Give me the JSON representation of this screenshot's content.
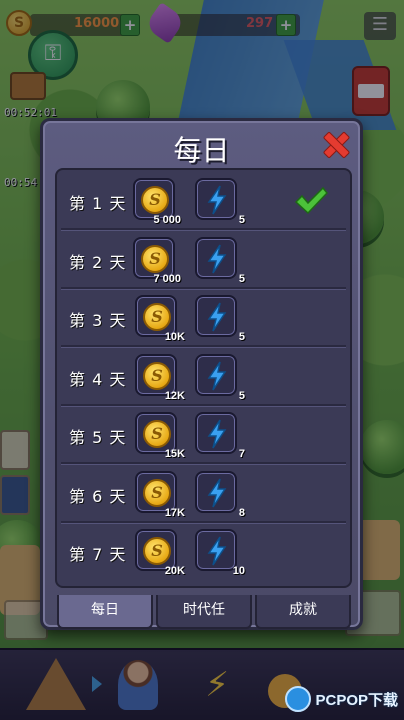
{
  "hud": {
    "coins": "16000",
    "gems": "297",
    "plus": "+",
    "timer_top": "00:52:01",
    "timer_bottom": "00:54"
  },
  "dialog": {
    "title": "每日",
    "close_icon": "close-x-icon",
    "days": [
      {
        "label": "第 1 天",
        "coins": "5 000",
        "energy": "5",
        "claimed": true
      },
      {
        "label": "第 2 天",
        "coins": "7 000",
        "energy": "5",
        "claimed": false
      },
      {
        "label": "第 3 天",
        "coins": "10K",
        "energy": "5",
        "claimed": false
      },
      {
        "label": "第 4 天",
        "coins": "12K",
        "energy": "5",
        "claimed": false
      },
      {
        "label": "第 5 天",
        "coins": "15K",
        "energy": "7",
        "claimed": false
      },
      {
        "label": "第 6 天",
        "coins": "17K",
        "energy": "8",
        "claimed": false
      },
      {
        "label": "第 7 天",
        "coins": "20K",
        "energy": "10",
        "claimed": false
      }
    ],
    "tabs": [
      "每日",
      "时代任",
      "成就"
    ],
    "active_tab": 0
  },
  "watermark": {
    "text": "PCPOP下载"
  },
  "colors": {
    "close": "#e43b30",
    "check": "#4cc23a",
    "coin": "#e7a915",
    "energy": "#3aa0f0",
    "panel": "#5d5c80"
  }
}
